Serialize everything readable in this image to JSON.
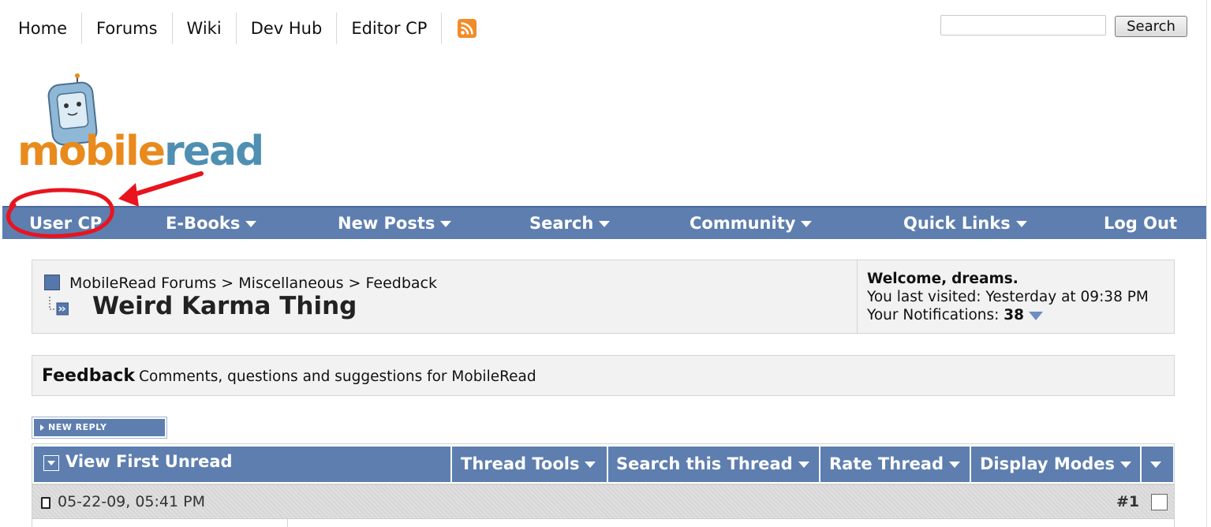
{
  "top_nav": {
    "items": [
      "Home",
      "Forums",
      "Wiki",
      "Dev Hub",
      "Editor CP"
    ],
    "rss_icon": "rss-feed-icon"
  },
  "search": {
    "placeholder": "",
    "button_label": "Search"
  },
  "logo": {
    "prefix": "mobile",
    "suffix": "read"
  },
  "main_nav": {
    "items": [
      {
        "label": "User CP",
        "dropdown": false
      },
      {
        "label": "E-Books",
        "dropdown": true
      },
      {
        "label": "New Posts",
        "dropdown": true
      },
      {
        "label": "Search",
        "dropdown": true
      },
      {
        "label": "Community",
        "dropdown": true
      },
      {
        "label": "Quick Links",
        "dropdown": true
      },
      {
        "label": "Log Out",
        "dropdown": false
      }
    ]
  },
  "annotation": {
    "color": "#e8141e",
    "target": "User CP"
  },
  "breadcrumb": {
    "root": "MobileRead Forums",
    "level1": "Miscellaneous",
    "level2": "Feedback",
    "separator": ">",
    "thread_title": "Weird Karma Thing"
  },
  "welcome": {
    "greeting_prefix": "Welcome,",
    "username": "dreams.",
    "last_visited": "You last visited: Yesterday at 09:38 PM",
    "notifications_label": "Your Notifications:",
    "notifications_count": "38"
  },
  "forum_desc": {
    "name": "Feedback",
    "text": "Comments, questions and suggestions for MobileRead"
  },
  "new_reply": {
    "label": "NEW REPLY"
  },
  "toolbar": {
    "view_first_unread": "View First Unread",
    "thread_tools": "Thread Tools",
    "search_thread": "Search this Thread",
    "rate_thread": "Rate Thread",
    "display_modes": "Display Modes"
  },
  "post": {
    "date": "05-22-09, 05:41 PM",
    "number": "#1"
  },
  "colors": {
    "nav_blue": "#5d7eaf",
    "box_bg": "#f2f2f2",
    "logo_orange": "#e88a1c",
    "logo_blue": "#4f8fb2"
  }
}
